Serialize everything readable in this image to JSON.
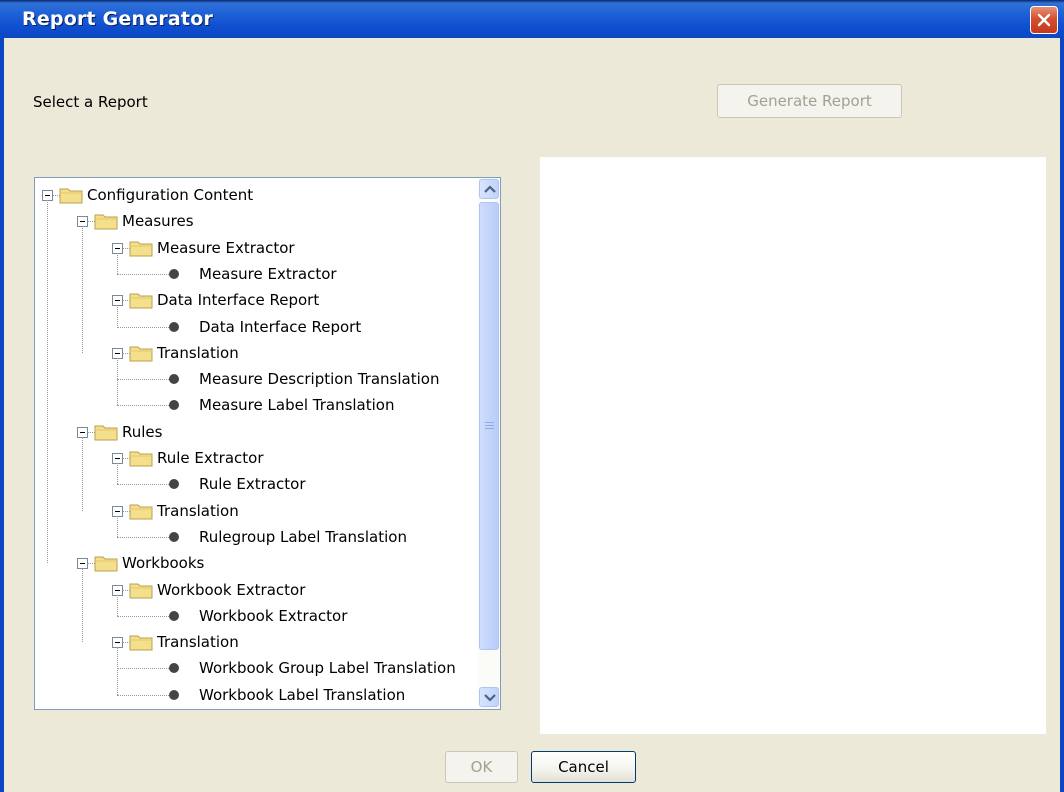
{
  "window": {
    "title": "Report Generator",
    "close_icon": "close-x-icon"
  },
  "select_label": "Select a Report",
  "buttons": {
    "generate_report": "Generate Report",
    "ok": "OK",
    "cancel": "Cancel"
  },
  "tree": {
    "rows": [
      {
        "label": "Configuration Content",
        "type": "folder",
        "depth": 0
      },
      {
        "label": "Measures",
        "type": "folder",
        "depth": 1
      },
      {
        "label": "Measure Extractor",
        "type": "folder",
        "depth": 2
      },
      {
        "label": "Measure Extractor",
        "type": "leaf",
        "depth": 3
      },
      {
        "label": "Data Interface Report",
        "type": "folder",
        "depth": 2
      },
      {
        "label": "Data Interface Report",
        "type": "leaf",
        "depth": 3
      },
      {
        "label": "Translation",
        "type": "folder",
        "depth": 2
      },
      {
        "label": "Measure Description Translation",
        "type": "leaf",
        "depth": 3
      },
      {
        "label": "Measure Label Translation",
        "type": "leaf",
        "depth": 3
      },
      {
        "label": "Rules",
        "type": "folder",
        "depth": 1
      },
      {
        "label": "Rule Extractor",
        "type": "folder",
        "depth": 2
      },
      {
        "label": "Rule Extractor",
        "type": "leaf",
        "depth": 3
      },
      {
        "label": "Translation",
        "type": "folder",
        "depth": 2
      },
      {
        "label": "Rulegroup Label Translation",
        "type": "leaf",
        "depth": 3
      },
      {
        "label": "Workbooks",
        "type": "folder",
        "depth": 1
      },
      {
        "label": "Workbook Extractor",
        "type": "folder",
        "depth": 2
      },
      {
        "label": "Workbook Extractor",
        "type": "leaf",
        "depth": 3
      },
      {
        "label": "Translation",
        "type": "folder",
        "depth": 2
      },
      {
        "label": "Workbook Group Label Translation",
        "type": "leaf",
        "depth": 3
      },
      {
        "label": "Workbook Label Translation",
        "type": "leaf",
        "depth": 3
      }
    ]
  },
  "icons": {
    "folder": "folder-icon",
    "leaf": "leaf-node-icon",
    "collapse": "collapse-minus-icon",
    "scroll_up": "scroll-up-arrow-icon",
    "scroll_down": "scroll-down-arrow-icon"
  },
  "colors": {
    "title_bar": "#0b47c2",
    "dialog_bg": "#ece9d8",
    "close_button": "#d5502f",
    "folder": "#f4e08c"
  }
}
